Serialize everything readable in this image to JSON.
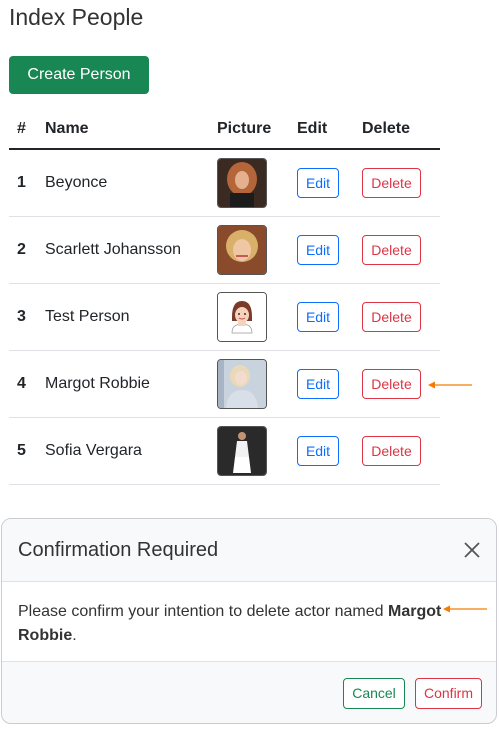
{
  "page": {
    "title": "Index People"
  },
  "actions": {
    "create_label": "Create Person"
  },
  "table": {
    "headers": [
      "#",
      "Name",
      "Picture",
      "Edit",
      "Delete"
    ],
    "rows": [
      {
        "num": "1",
        "name": "Beyonce",
        "edit": "Edit",
        "delete": "Delete"
      },
      {
        "num": "2",
        "name": "Scarlett Johansson",
        "edit": "Edit",
        "delete": "Delete"
      },
      {
        "num": "3",
        "name": "Test Person",
        "edit": "Edit",
        "delete": "Delete"
      },
      {
        "num": "4",
        "name": "Margot Robbie",
        "edit": "Edit",
        "delete": "Delete"
      },
      {
        "num": "5",
        "name": "Sofia Vergara",
        "edit": "Edit",
        "delete": "Delete"
      }
    ]
  },
  "modal": {
    "title": "Confirmation Required",
    "message_prefix": "Please confirm your intention to delete actor named ",
    "actor_name": "Margot Robbie",
    "message_suffix": ".",
    "cancel_label": "Cancel",
    "confirm_label": "Confirm"
  },
  "colors": {
    "primary": "#0d6efd",
    "success": "#198754",
    "danger": "#dc3545",
    "annotation_arrow": "#f57c00"
  }
}
